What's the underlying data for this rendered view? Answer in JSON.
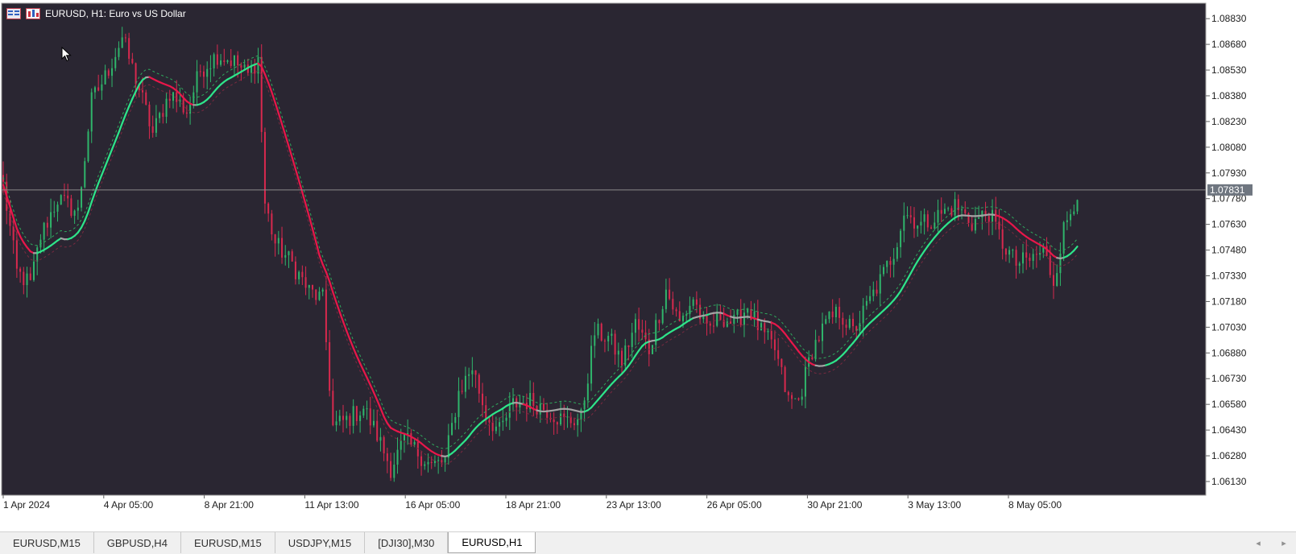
{
  "chart_title": "EURUSD, H1:  Euro vs US Dollar",
  "theme": {
    "background": "#2a2632",
    "frame": "#ffffff",
    "axis_text": "#d8d8d8",
    "bull": "#2fb56b",
    "bear": "#d8294e",
    "ma_up": "#2ee58a",
    "ma_down": "#e8174a",
    "ma_flat": "#a4a4a4",
    "bid_line": "#8a8a8a",
    "price_label_bg": "#6f7680"
  },
  "chart_data": {
    "type": "candlestick",
    "symbol": "EURUSD",
    "timeframe": "H1",
    "ylim": [
      1.0605,
      1.0892
    ],
    "y_ticks": [
      "1.08830",
      "1.08680",
      "1.08530",
      "1.08380",
      "1.08230",
      "1.08080",
      "1.07930",
      "1.07780",
      "1.07630",
      "1.07480",
      "1.07330",
      "1.07180",
      "1.07030",
      "1.06880",
      "1.06730",
      "1.06580",
      "1.06430",
      "1.06280",
      "1.06130"
    ],
    "x_ticks": [
      "1 Apr 2024",
      "4 Apr 05:00",
      "8 Apr 21:00",
      "11 Apr 13:00",
      "16 Apr 05:00",
      "18 Apr 21:00",
      "23 Apr 13:00",
      "26 Apr 05:00",
      "30 Apr 21:00",
      "3 May 13:00",
      "8 May 05:00"
    ],
    "bid_price": 1.07831,
    "bid_label": "1.07831",
    "close_anchors": [
      {
        "bar": 0,
        "close": 1.0786
      },
      {
        "bar": 4,
        "close": 1.0735
      },
      {
        "bar": 8,
        "close": 1.0728
      },
      {
        "bar": 11,
        "close": 1.0756
      },
      {
        "bar": 16,
        "close": 1.0778
      },
      {
        "bar": 22,
        "close": 1.077
      },
      {
        "bar": 26,
        "close": 1.0835
      },
      {
        "bar": 30,
        "close": 1.0849
      },
      {
        "bar": 35,
        "close": 1.0872
      },
      {
        "bar": 40,
        "close": 1.0842
      },
      {
        "bar": 44,
        "close": 1.0816
      },
      {
        "bar": 49,
        "close": 1.084
      },
      {
        "bar": 54,
        "close": 1.0829
      },
      {
        "bar": 58,
        "close": 1.0853
      },
      {
        "bar": 63,
        "close": 1.0862
      },
      {
        "bar": 68,
        "close": 1.0858
      },
      {
        "bar": 72,
        "close": 1.085
      },
      {
        "bar": 75,
        "close": 1.086
      },
      {
        "bar": 77,
        "close": 1.0775
      },
      {
        "bar": 80,
        "close": 1.0752
      },
      {
        "bar": 85,
        "close": 1.074
      },
      {
        "bar": 90,
        "close": 1.0724
      },
      {
        "bar": 94,
        "close": 1.0719
      },
      {
        "bar": 97,
        "close": 1.0645
      },
      {
        "bar": 101,
        "close": 1.0649
      },
      {
        "bar": 106,
        "close": 1.0656
      },
      {
        "bar": 110,
        "close": 1.064
      },
      {
        "bar": 114,
        "close": 1.0621
      },
      {
        "bar": 118,
        "close": 1.0637
      },
      {
        "bar": 122,
        "close": 1.063
      },
      {
        "bar": 126,
        "close": 1.0622
      },
      {
        "bar": 130,
        "close": 1.0625
      },
      {
        "bar": 134,
        "close": 1.0665
      },
      {
        "bar": 138,
        "close": 1.068
      },
      {
        "bar": 142,
        "close": 1.0652
      },
      {
        "bar": 146,
        "close": 1.0642
      },
      {
        "bar": 150,
        "close": 1.0658
      },
      {
        "bar": 155,
        "close": 1.066
      },
      {
        "bar": 160,
        "close": 1.0655
      },
      {
        "bar": 165,
        "close": 1.0648
      },
      {
        "bar": 170,
        "close": 1.065
      },
      {
        "bar": 174,
        "close": 1.07
      },
      {
        "bar": 178,
        "close": 1.0697
      },
      {
        "bar": 182,
        "close": 1.0683
      },
      {
        "bar": 186,
        "close": 1.0705
      },
      {
        "bar": 190,
        "close": 1.069
      },
      {
        "bar": 195,
        "close": 1.0725
      },
      {
        "bar": 199,
        "close": 1.0705
      },
      {
        "bar": 203,
        "close": 1.072
      },
      {
        "bar": 207,
        "close": 1.07
      },
      {
        "bar": 211,
        "close": 1.071
      },
      {
        "bar": 215,
        "close": 1.0705
      },
      {
        "bar": 219,
        "close": 1.0715
      },
      {
        "bar": 223,
        "close": 1.07
      },
      {
        "bar": 227,
        "close": 1.069
      },
      {
        "bar": 231,
        "close": 1.066
      },
      {
        "bar": 234,
        "close": 1.066
      },
      {
        "bar": 238,
        "close": 1.069
      },
      {
        "bar": 242,
        "close": 1.0705
      },
      {
        "bar": 246,
        "close": 1.0712
      },
      {
        "bar": 250,
        "close": 1.07
      },
      {
        "bar": 254,
        "close": 1.0715
      },
      {
        "bar": 258,
        "close": 1.073
      },
      {
        "bar": 262,
        "close": 1.0747
      },
      {
        "bar": 265,
        "close": 1.077
      },
      {
        "bar": 270,
        "close": 1.0763
      },
      {
        "bar": 275,
        "close": 1.0768
      },
      {
        "bar": 280,
        "close": 1.0774
      },
      {
        "bar": 285,
        "close": 1.0764
      },
      {
        "bar": 290,
        "close": 1.077
      },
      {
        "bar": 294,
        "close": 1.0752
      },
      {
        "bar": 298,
        "close": 1.074
      },
      {
        "bar": 302,
        "close": 1.0742
      },
      {
        "bar": 306,
        "close": 1.0748
      },
      {
        "bar": 309,
        "close": 1.073
      },
      {
        "bar": 312,
        "close": 1.076
      },
      {
        "bar": 316,
        "close": 1.0782
      }
    ],
    "ma_period": 18
  },
  "tabs": [
    {
      "label": "EURUSD,M15",
      "active": false
    },
    {
      "label": "GBPUSD,H4",
      "active": false
    },
    {
      "label": "EURUSD,M15",
      "active": false
    },
    {
      "label": "USDJPY,M15",
      "active": false
    },
    {
      "label": "[DJI30],M30",
      "active": false
    },
    {
      "label": "EURUSD,H1",
      "active": true
    }
  ],
  "tab_scroll": {
    "left_icon": "chevron-left-icon",
    "right_icon": "chevron-right-icon",
    "left_glyph": "◂",
    "right_glyph": "▸"
  }
}
